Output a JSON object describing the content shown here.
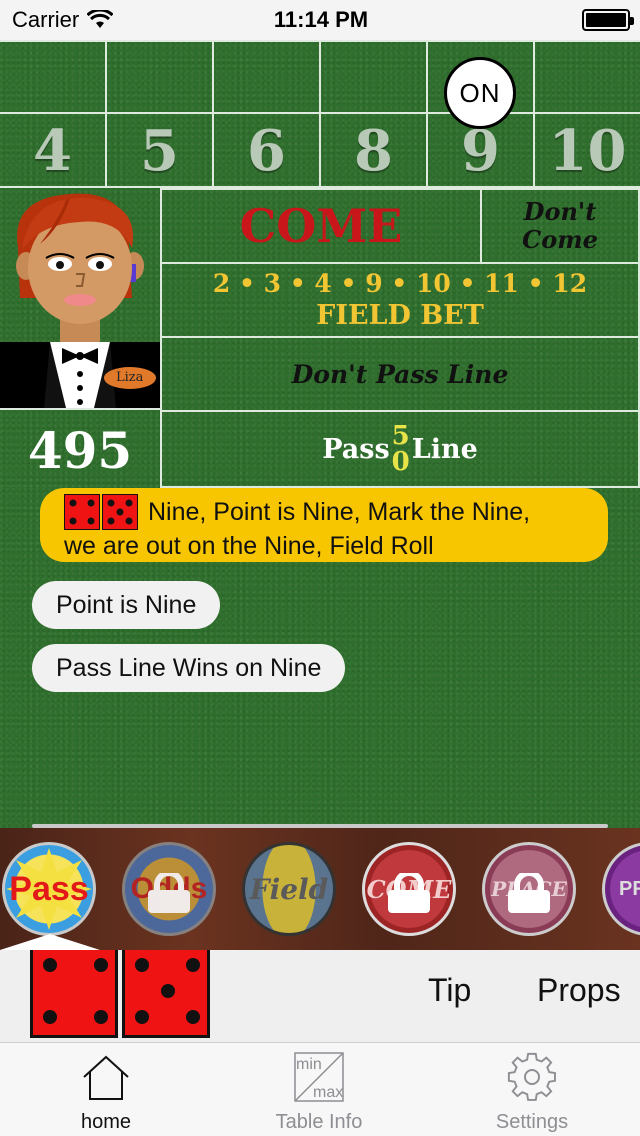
{
  "status_bar": {
    "carrier": "Carrier",
    "time": "11:14 PM"
  },
  "table": {
    "point_numbers": [
      "4",
      "5",
      "6",
      "8",
      "9",
      "10"
    ],
    "puck_label": "ON",
    "come_label": "COME",
    "dont_come_line1": "Don't",
    "dont_come_line2": "Come",
    "field_numbers": "2 • 3 • 4 • 9 • 10 • 11 • 12",
    "field_label": "FIELD BET",
    "dont_pass_label": "Don't Pass Line",
    "pass_label_left": "Pass",
    "pass_label_right": "Line",
    "pass_bet_top": "5",
    "pass_bet_bottom": "0",
    "dealer_name": "Liza",
    "bankroll": "495"
  },
  "chat": {
    "messages": [
      "Nine, Point is Nine, Mark the Nine, we are out on the Nine, Field Roll",
      "Point is Nine",
      "Pass Line Wins on Nine"
    ],
    "message_1_line1": "Nine, Point is Nine, Mark the Nine,",
    "message_1_line2": "we are out on the Nine, Field Roll"
  },
  "bet_carousel": {
    "chips": [
      {
        "label": "Pass",
        "locked": false,
        "selected": true
      },
      {
        "label": "Odds",
        "locked": true
      },
      {
        "label": "Field",
        "locked": false
      },
      {
        "label": "COME",
        "locked": true
      },
      {
        "label": "PLACE",
        "locked": true
      },
      {
        "label": "PR",
        "locked": true
      }
    ]
  },
  "dice": {
    "die1": 4,
    "die2": 5
  },
  "actions": {
    "tip": "Tip",
    "props": "Props"
  },
  "tabs": [
    {
      "label": "home",
      "icon": "house-icon",
      "active": true
    },
    {
      "label": "Table Info",
      "icon": "min-max-icon",
      "active": false
    },
    {
      "label": "Settings",
      "icon": "gear-icon",
      "active": false
    }
  ],
  "tab_min": "min",
  "tab_max": "max",
  "colors": {
    "felt": "#2f6f2d",
    "come_red": "#c8161b",
    "field_yellow": "#f2c533",
    "bubble_yellow": "#f7c600",
    "die_red": "#ef1313",
    "tab_active": "#111111",
    "tab_inactive": "#8e8e93"
  }
}
